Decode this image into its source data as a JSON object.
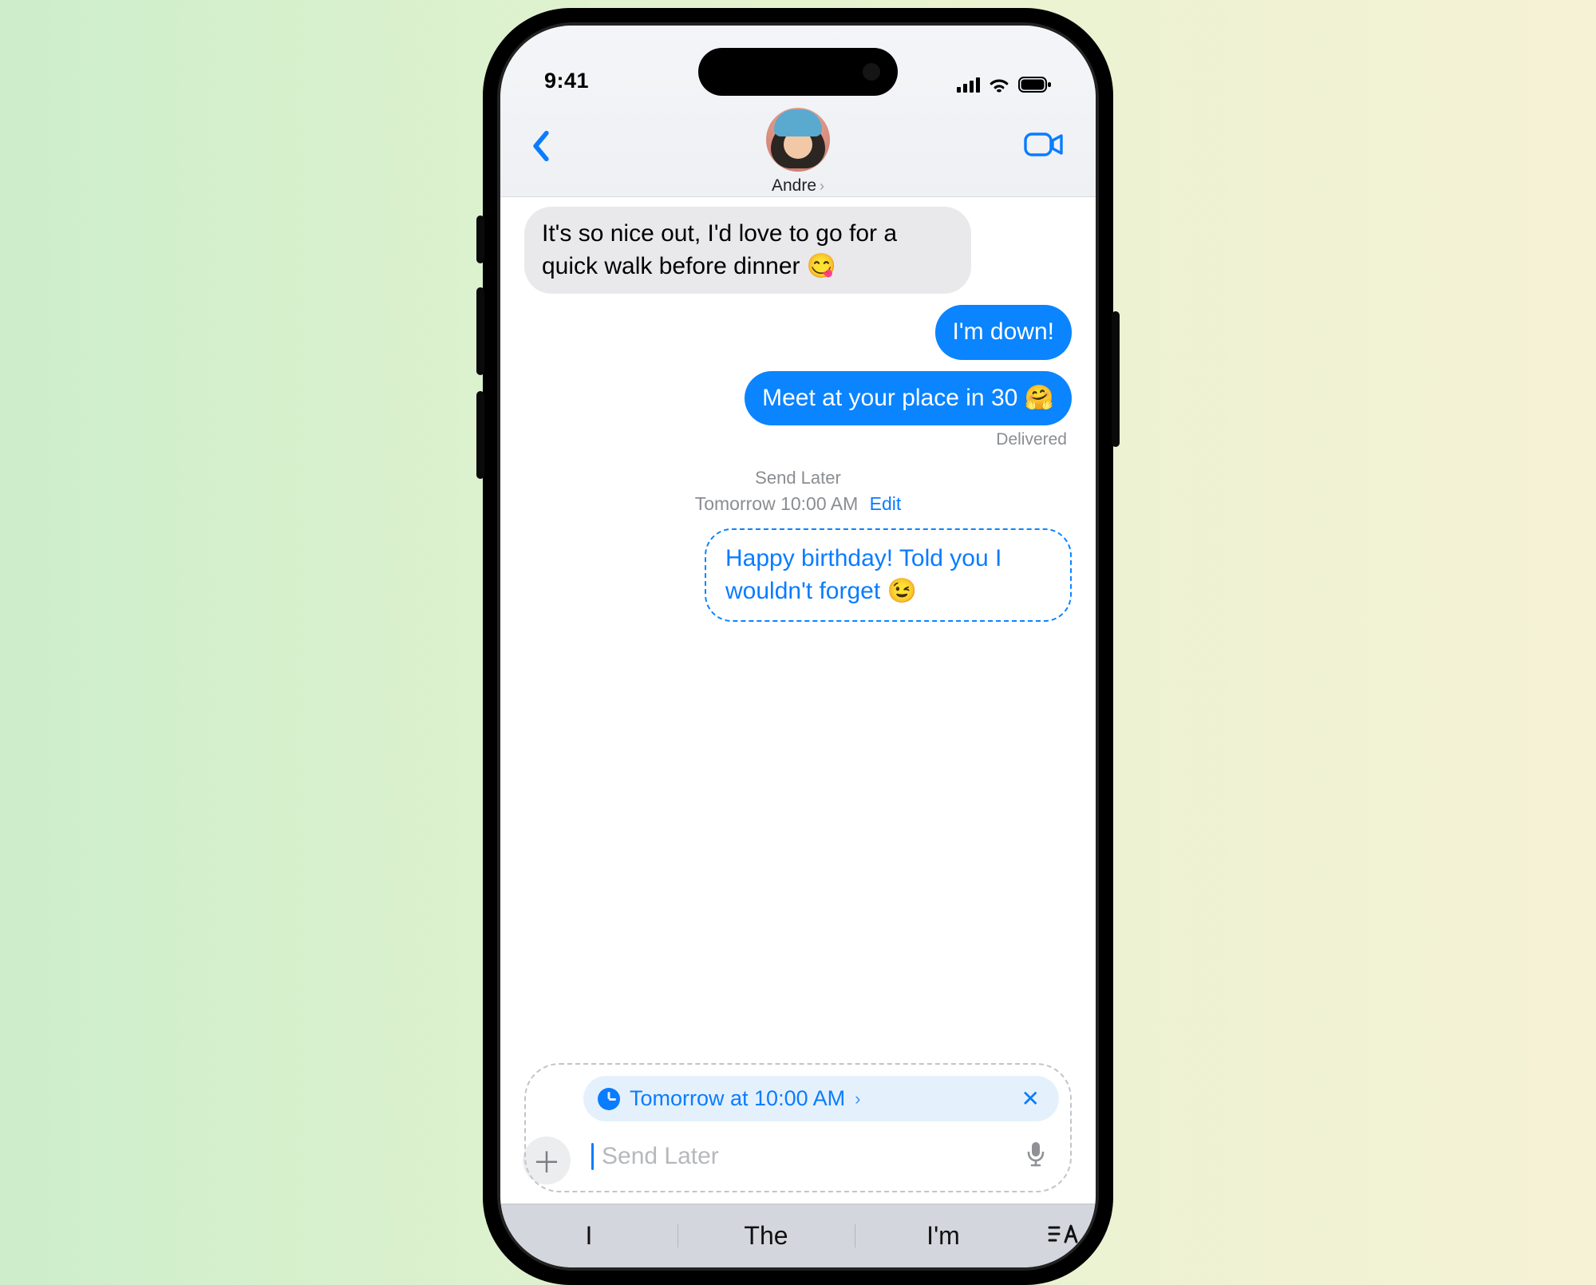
{
  "status": {
    "time": "9:41"
  },
  "header": {
    "contact_name": "Andre"
  },
  "messages": {
    "incoming1": "It's so nice out, I'd love to go for a quick walk before dinner 😋",
    "outgoing1": "I'm down!",
    "outgoing2": "Meet at your place in 30 🤗",
    "delivered_label": "Delivered",
    "send_later_label": "Send Later",
    "send_later_time": "Tomorrow 10:00 AM",
    "edit_label": "Edit",
    "scheduled": "Happy birthday! Told you I wouldn't forget 😉"
  },
  "compose": {
    "schedule_text": "Tomorrow at 10:00 AM",
    "placeholder": "Send Later"
  },
  "keyboard": {
    "sugg1": "I",
    "sugg2": "The",
    "sugg3": "I'm"
  }
}
